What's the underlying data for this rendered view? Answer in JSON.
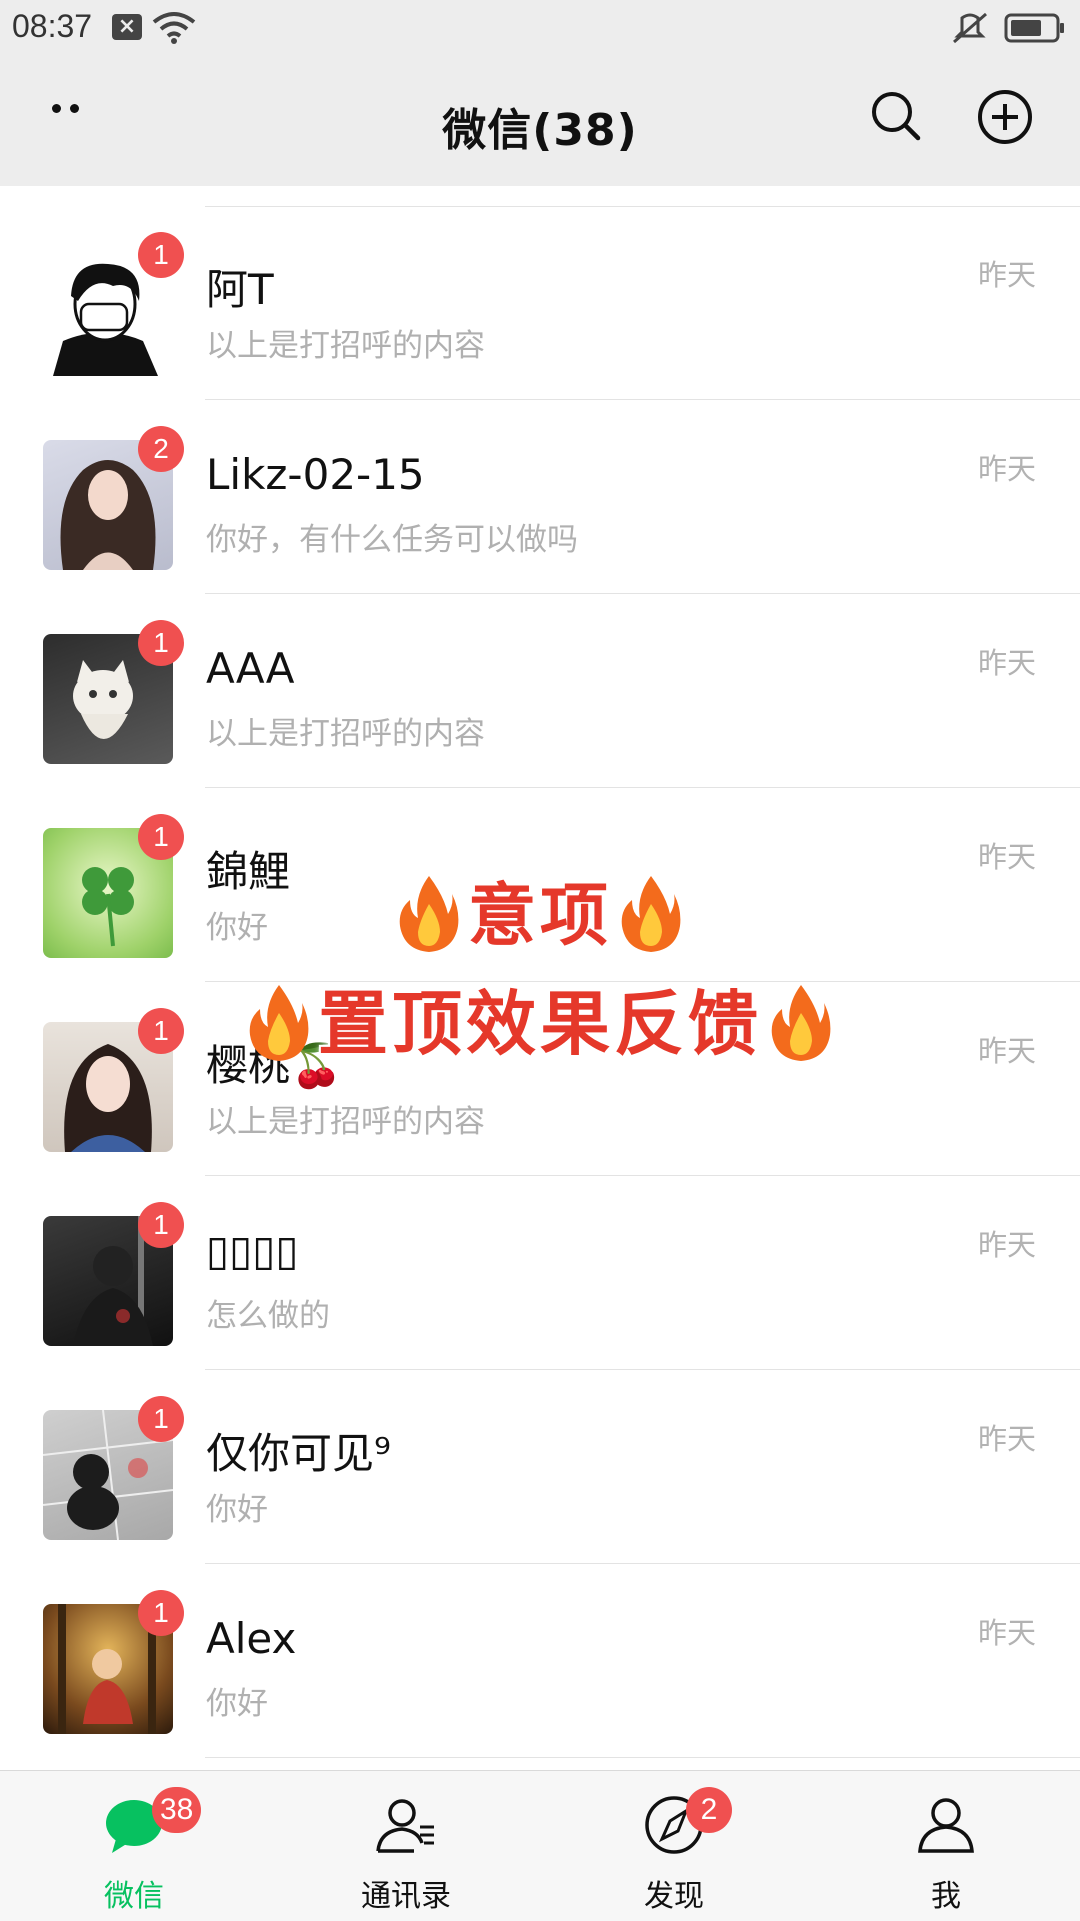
{
  "status_bar": {
    "time": "08:37"
  },
  "header": {
    "title": "微信(38)"
  },
  "chats": [
    {
      "name": "阿T",
      "preview": "以上是打招呼的内容",
      "time": "昨天",
      "unread": "1"
    },
    {
      "name": "Likz-02-15",
      "preview": "你好，有什么任务可以做吗",
      "time": "昨天",
      "unread": "2"
    },
    {
      "name": "AAA",
      "preview": "以上是打招呼的内容",
      "time": "昨天",
      "unread": "1"
    },
    {
      "name": "錦鯉",
      "preview": "你好",
      "time": "昨天",
      "unread": "1"
    },
    {
      "name": "樱桃🍒",
      "preview": "以上是打招呼的内容",
      "time": "昨天",
      "unread": "1"
    },
    {
      "name": "▯▯▯▯",
      "preview": "怎么做的",
      "time": "昨天",
      "unread": "1"
    },
    {
      "name": "仅你可见⁹",
      "preview": "你好",
      "time": "昨天",
      "unread": "1"
    },
    {
      "name": "Alex",
      "preview": "你好",
      "time": "昨天",
      "unread": "1"
    }
  ],
  "overlay": {
    "line1": "意项",
    "line2": "置顶效果反馈"
  },
  "tabs": [
    {
      "label": "微信",
      "badge": "38"
    },
    {
      "label": "通讯录"
    },
    {
      "label": "发现",
      "badge": "2"
    },
    {
      "label": "我"
    }
  ],
  "colors": {
    "accent": "#07c160",
    "badge": "#f05050",
    "overlay_text": "#e5382a"
  }
}
